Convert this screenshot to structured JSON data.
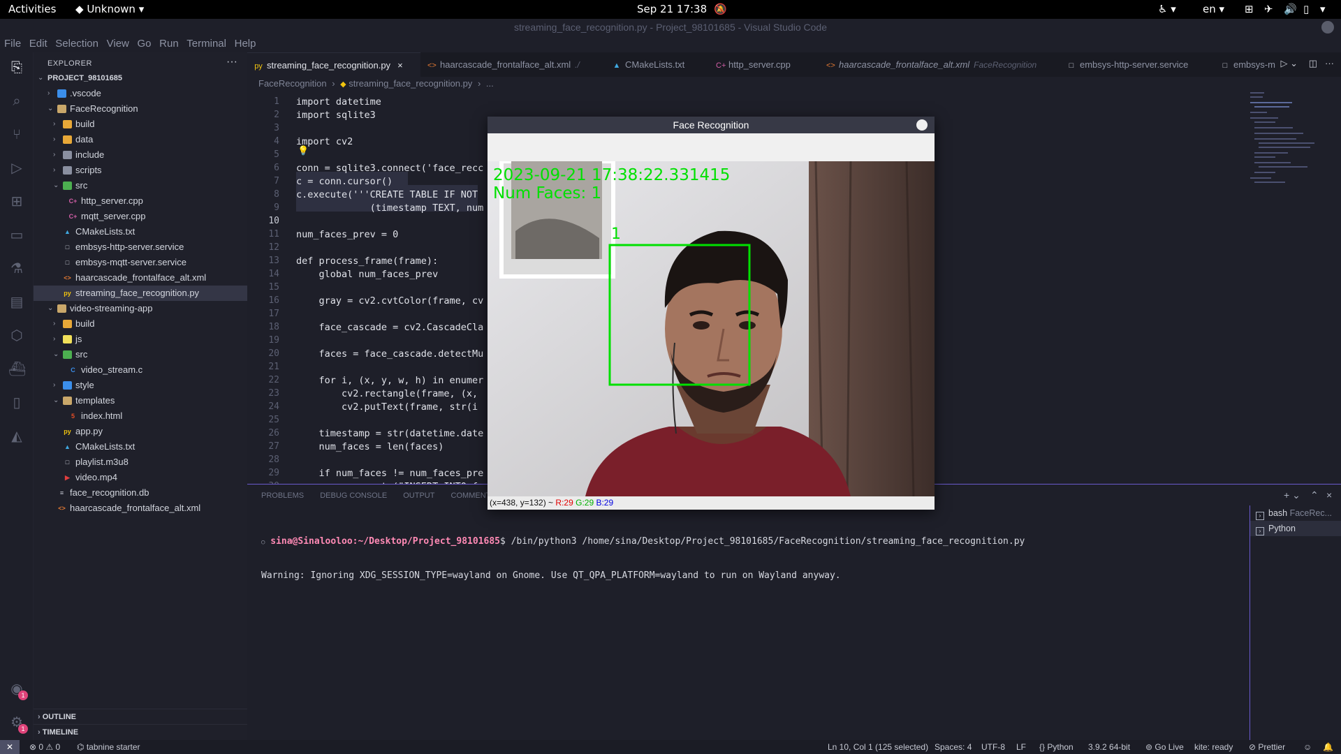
{
  "system_bar": {
    "activities": "Activities",
    "app_name": "Unknown",
    "clock": "Sep 21  17:38",
    "lang": "en"
  },
  "window_title": "streaming_face_recognition.py - Project_98101685 - Visual Studio Code",
  "menu": [
    "File",
    "Edit",
    "Selection",
    "View",
    "Go",
    "Run",
    "Terminal",
    "Help"
  ],
  "explorer": {
    "header": "EXPLORER",
    "project": "PROJECT_98101685",
    "items": [
      {
        "label": ".vscode",
        "depth": 1,
        "kind": "folder",
        "open": false,
        "color": "#3b8eea"
      },
      {
        "label": "FaceRecognition",
        "depth": 1,
        "kind": "folder",
        "open": true,
        "color": "#c9a76a"
      },
      {
        "label": "build",
        "depth": 2,
        "kind": "folder",
        "open": false,
        "color": "#e8a838"
      },
      {
        "label": "data",
        "depth": 2,
        "kind": "folder",
        "open": false,
        "color": "#e8a838"
      },
      {
        "label": "include",
        "depth": 2,
        "kind": "folder",
        "open": false,
        "color": "#8a8fa0"
      },
      {
        "label": "scripts",
        "depth": 2,
        "kind": "folder",
        "open": false,
        "color": "#8a8fa0"
      },
      {
        "label": "src",
        "depth": 2,
        "kind": "folder",
        "open": true,
        "color": "#4caf50"
      },
      {
        "label": "http_server.cpp",
        "depth": 3,
        "kind": "file",
        "icon": "C+",
        "color": "#d35fa8"
      },
      {
        "label": "mqtt_server.cpp",
        "depth": 3,
        "kind": "file",
        "icon": "C+",
        "color": "#d35fa8"
      },
      {
        "label": "CMakeLists.txt",
        "depth": 2,
        "kind": "file",
        "icon": "▲",
        "color": "#3fa8e0"
      },
      {
        "label": "embsys-http-server.service",
        "depth": 2,
        "kind": "file",
        "icon": "□",
        "color": "#c7cad4"
      },
      {
        "label": "embsys-mqtt-server.service",
        "depth": 2,
        "kind": "file",
        "icon": "□",
        "color": "#c7cad4"
      },
      {
        "label": "haarcascade_frontalface_alt.xml",
        "depth": 2,
        "kind": "file",
        "icon": "<>",
        "color": "#e37933"
      },
      {
        "label": "streaming_face_recognition.py",
        "depth": 2,
        "kind": "file",
        "icon": "py",
        "color": "#f1c40f",
        "selected": true
      },
      {
        "label": "video-streaming-app",
        "depth": 1,
        "kind": "folder",
        "open": true,
        "color": "#c9a76a"
      },
      {
        "label": "build",
        "depth": 2,
        "kind": "folder",
        "open": false,
        "color": "#e8a838"
      },
      {
        "label": "js",
        "depth": 2,
        "kind": "folder",
        "open": false,
        "color": "#f1e05a"
      },
      {
        "label": "src",
        "depth": 2,
        "kind": "folder",
        "open": true,
        "color": "#4caf50"
      },
      {
        "label": "video_stream.c",
        "depth": 3,
        "kind": "file",
        "icon": "C",
        "color": "#3b8eea"
      },
      {
        "label": "style",
        "depth": 2,
        "kind": "folder",
        "open": false,
        "color": "#3b8eea"
      },
      {
        "label": "templates",
        "depth": 2,
        "kind": "folder",
        "open": true,
        "color": "#c9a76a"
      },
      {
        "label": "index.html",
        "depth": 3,
        "kind": "file",
        "icon": "5",
        "color": "#e44d26"
      },
      {
        "label": "app.py",
        "depth": 2,
        "kind": "file",
        "icon": "py",
        "color": "#f1c40f"
      },
      {
        "label": "CMakeLists.txt",
        "depth": 2,
        "kind": "file",
        "icon": "▲",
        "color": "#3fa8e0"
      },
      {
        "label": "playlist.m3u8",
        "depth": 2,
        "kind": "file",
        "icon": "□",
        "color": "#c7cad4"
      },
      {
        "label": "video.mp4",
        "depth": 2,
        "kind": "file",
        "icon": "▶",
        "color": "#e03e3e"
      },
      {
        "label": "face_recognition.db",
        "depth": 1,
        "kind": "file",
        "icon": "≡",
        "color": "#c7cad4"
      },
      {
        "label": "haarcascade_frontalface_alt.xml",
        "depth": 1,
        "kind": "file",
        "icon": "<>",
        "color": "#e37933"
      }
    ],
    "outline": "OUTLINE",
    "timeline": "TIMELINE"
  },
  "tabs": [
    {
      "label": "streaming_face_recognition.py",
      "icon": "py",
      "color": "#f1c40f",
      "active": true,
      "close": "×"
    },
    {
      "label": "haarcascade_frontalface_alt.xml",
      "icon": "<>",
      "color": "#e37933",
      "sub": "./"
    },
    {
      "label": "CMakeLists.txt",
      "icon": "▲",
      "color": "#3fa8e0"
    },
    {
      "label": "http_server.cpp",
      "icon": "C+",
      "color": "#d35fa8"
    },
    {
      "label": "haarcascade_frontalface_alt.xml",
      "icon": "<>",
      "color": "#e37933",
      "sub": "FaceRecognition",
      "italic": true
    },
    {
      "label": "embsys-http-server.service",
      "icon": "□",
      "color": "#c7cad4"
    },
    {
      "label": "embsys-m",
      "icon": "□",
      "color": "#c7cad4"
    }
  ],
  "breadcrumb": [
    "FaceRecognition",
    "streaming_face_recognition.py",
    "..."
  ],
  "code_lines": [
    {
      "n": "1",
      "t": "import datetime"
    },
    {
      "n": "2",
      "t": "import sqlite3"
    },
    {
      "n": "3",
      "t": ""
    },
    {
      "n": "4",
      "t": "import cv2"
    },
    {
      "n": "5",
      "t": ""
    },
    {
      "n": "6",
      "t": "conn = sqlite3.connect('face_recc"
    },
    {
      "n": "7",
      "t": "c = conn.cursor()"
    },
    {
      "n": "8",
      "t": "c.execute('''CREATE TABLE IF NOT"
    },
    {
      "n": "9",
      "t": "             (timestamp TEXT, num"
    },
    {
      "n": "10",
      "t": ""
    },
    {
      "n": "11",
      "t": "num_faces_prev = 0"
    },
    {
      "n": "12",
      "t": ""
    },
    {
      "n": "13",
      "t": "def process_frame(frame):"
    },
    {
      "n": "14",
      "t": "    global num_faces_prev"
    },
    {
      "n": "15",
      "t": ""
    },
    {
      "n": "16",
      "t": "    gray = cv2.cvtColor(frame, cv"
    },
    {
      "n": "17",
      "t": ""
    },
    {
      "n": "18",
      "t": "    face_cascade = cv2.CascadeCla"
    },
    {
      "n": "19",
      "t": ""
    },
    {
      "n": "20",
      "t": "    faces = face_cascade.detectMu"
    },
    {
      "n": "21",
      "t": ""
    },
    {
      "n": "22",
      "t": "    for i, (x, y, w, h) in enumer"
    },
    {
      "n": "23",
      "t": "        cv2.rectangle(frame, (x,"
    },
    {
      "n": "24",
      "t": "        cv2.putText(frame, str(i"
    },
    {
      "n": "25",
      "t": ""
    },
    {
      "n": "26",
      "t": "    timestamp = str(datetime.date"
    },
    {
      "n": "27",
      "t": "    num_faces = len(faces)"
    },
    {
      "n": "28",
      "t": ""
    },
    {
      "n": "29",
      "t": "    if num_faces != num_faces_pre"
    },
    {
      "n": "30",
      "t": "        c.execute(\"INSERT INTO fa"
    }
  ],
  "current_line": "10",
  "panel": {
    "tabs": [
      "PROBLEMS",
      "DEBUG CONSOLE",
      "OUTPUT",
      "COMMENTS"
    ],
    "prompt_user": "sina@Sinalooloo",
    "prompt_path": ":~/Desktop/Project_98101685",
    "command": "$ /bin/python3 /home/sina/Desktop/Project_98101685/FaceRecognition/streaming_face_recognition.py",
    "warning": "Warning: Ignoring XDG_SESSION_TYPE=wayland on Gnome. Use QT_QPA_PLATFORM=wayland to run on Wayland anyway.",
    "terminals": [
      {
        "name": "bash",
        "sub": "FaceRec..."
      },
      {
        "name": "Python",
        "sub": ""
      }
    ]
  },
  "statusbar": {
    "errors": "0",
    "warnings": "0",
    "tabnine": "tabnine starter",
    "position": "Ln 10, Col 1 (125 selected)",
    "spaces": "Spaces: 4",
    "encoding": "UTF-8",
    "eol": "LF",
    "language": "Python",
    "interpreter": "3.9.2 64-bit",
    "golive": "Go Live",
    "kite": "kite: ready",
    "prettier": "Prettier"
  },
  "cv_window": {
    "title": "Face Recognition",
    "timestamp": "2023-09-21 17:38:22.331415",
    "num_faces": "Num Faces: 1",
    "face_index": "1",
    "status_coords": "(x=438, y=132) ~",
    "status_r": "R:29",
    "status_g": "G:29",
    "status_b": "B:29"
  },
  "colors": {
    "accent": "#6a5acd",
    "overlay_green": "#00e000"
  }
}
